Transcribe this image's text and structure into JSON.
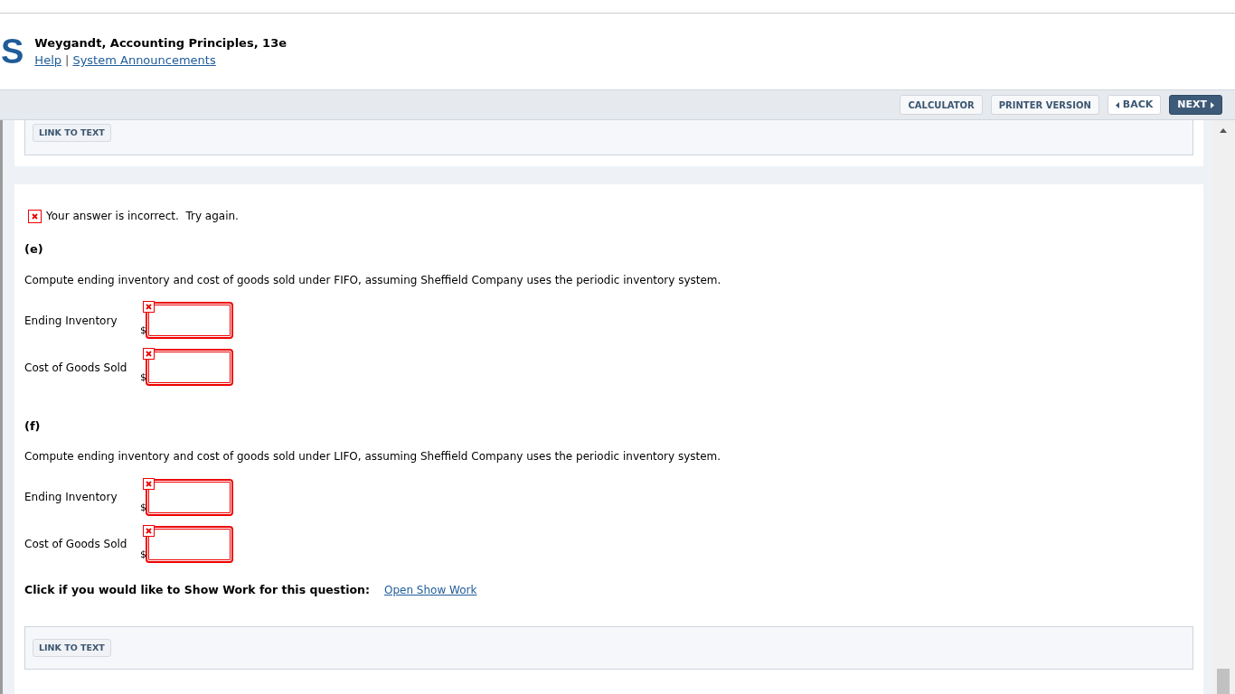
{
  "header": {
    "logo_text": "S",
    "title": "Weygandt, Accounting Principles, 13e",
    "links": [
      "Help",
      "System Announcements"
    ],
    "separator": "|"
  },
  "toolbar": {
    "buttons": [
      {
        "label": "CALCULATOR",
        "kind": "plain"
      },
      {
        "label": "PRINTER VERSION",
        "kind": "plain"
      },
      {
        "label": "BACK",
        "kind": "back"
      },
      {
        "label": "NEXT",
        "kind": "next"
      }
    ]
  },
  "top_panel": {
    "button": "LINK TO TEXT"
  },
  "feedback": {
    "incorrect": true,
    "text": "Your answer is incorrect.  Try again."
  },
  "parts": [
    {
      "label": "(e)",
      "prompt": "Compute ending inventory and cost of goods sold under FIFO, assuming Sheffield Company uses the periodic inventory system.",
      "fields": [
        {
          "label": "Ending Inventory",
          "currency": "$",
          "incorrect": true
        },
        {
          "label": "Cost of Goods Sold",
          "currency": "$",
          "incorrect": true
        }
      ]
    },
    {
      "label": "(f)",
      "prompt": "Compute ending inventory and cost of goods sold under LIFO, assuming Sheffield Company uses the periodic inventory system.",
      "fields": [
        {
          "label": "Ending Inventory",
          "currency": "$",
          "incorrect": true
        },
        {
          "label": "Cost of Goods Sold",
          "currency": "$",
          "incorrect": true
        }
      ]
    }
  ],
  "show_work": {
    "prompt": "Click if you would like to Show Work for this question:",
    "link": "Open Show Work"
  },
  "bottom_panel": {
    "button": "LINK TO TEXT"
  }
}
